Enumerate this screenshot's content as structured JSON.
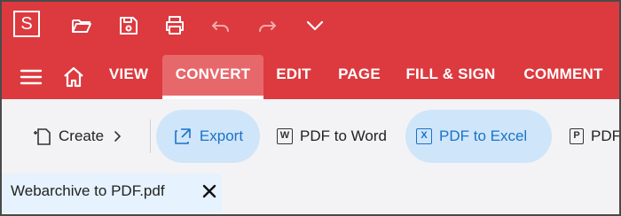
{
  "colors": {
    "brand_red": "#dc3a3f",
    "active_tab_bg": "#e7686b",
    "ribbon_bg": "#f3f3f5",
    "highlight_bg": "#cfe5fa",
    "highlight_text": "#1a73c8"
  },
  "app": {
    "logo_letter": "S"
  },
  "quick_access": [
    {
      "name": "open-folder-icon",
      "enabled": true
    },
    {
      "name": "save-icon",
      "enabled": true
    },
    {
      "name": "print-icon",
      "enabled": true
    },
    {
      "name": "undo-icon",
      "enabled": false
    },
    {
      "name": "redo-icon",
      "enabled": false
    },
    {
      "name": "chevron-down-icon",
      "enabled": true
    }
  ],
  "menu": {
    "items": [
      {
        "label": "VIEW",
        "active": false
      },
      {
        "label": "CONVERT",
        "active": true
      },
      {
        "label": "EDIT",
        "active": false
      },
      {
        "label": "PAGE",
        "active": false
      },
      {
        "label": "FILL & SIGN",
        "active": false
      },
      {
        "label": "COMMENT",
        "active": false
      }
    ]
  },
  "ribbon": {
    "create_label": "Create",
    "export_label": "Export",
    "pdf_to_word": {
      "label": "PDF to Word",
      "icon_letter": "W"
    },
    "pdf_to_excel": {
      "label": "PDF to Excel",
      "icon_letter": "X"
    },
    "pdf_to_ppt": {
      "label": "PDF",
      "icon_letter": "P"
    }
  },
  "document_tab": {
    "label": "Webarchive to PDF.pdf"
  }
}
